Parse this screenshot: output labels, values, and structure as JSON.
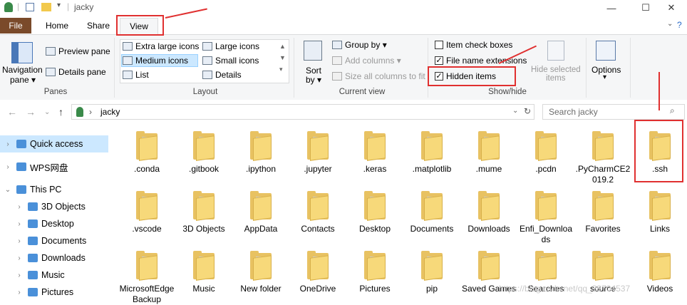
{
  "window": {
    "title": "jacky",
    "controls": {
      "minimize": "—",
      "maximize": "☐",
      "close": "✕"
    }
  },
  "ribbon_tabs": [
    "File",
    "Home",
    "Share",
    "View"
  ],
  "ribbon": {
    "panes": {
      "label": "Panes",
      "navigation_pane": "Navigation",
      "navigation_pane_2": "pane ▾",
      "preview_pane": "Preview pane",
      "details_pane": "Details pane"
    },
    "layout": {
      "label": "Layout",
      "options": [
        "Extra large icons",
        "Large icons",
        "Medium icons",
        "Small icons",
        "List",
        "Details"
      ]
    },
    "current_view": {
      "label": "Current view",
      "sort_by_1": "Sort",
      "sort_by_2": "by ▾",
      "group_by": "Group by ▾",
      "add_columns": "Add columns ▾",
      "size_columns": "Size all columns to fit"
    },
    "show_hide": {
      "label": "Show/hide",
      "item_check_boxes": "Item check boxes",
      "file_name_extensions": "File name extensions",
      "hidden_items": "Hidden items",
      "hide_selected_1": "Hide selected",
      "hide_selected_2": "items"
    },
    "options": {
      "label": "Options",
      "sub": "▾"
    }
  },
  "address": {
    "path": "jacky",
    "search_placeholder": "Search jacky"
  },
  "nav": [
    {
      "label": "Quick access",
      "chev": "›",
      "selected": true
    },
    {
      "label": "WPS网盘",
      "chev": "›"
    },
    {
      "label": "This PC",
      "chev": "⌄"
    },
    {
      "label": "3D Objects",
      "chev": "›"
    },
    {
      "label": "Desktop",
      "chev": "›"
    },
    {
      "label": "Documents",
      "chev": "›"
    },
    {
      "label": "Downloads",
      "chev": "›"
    },
    {
      "label": "Music",
      "chev": "›"
    },
    {
      "label": "Pictures",
      "chev": "›"
    }
  ],
  "items": [
    ".conda",
    ".gitbook",
    ".ipython",
    ".jupyter",
    ".keras",
    ".matplotlib",
    ".mume",
    ".pcdn",
    ".PyCharmCE2019.2",
    ".ssh",
    ".vscode",
    "3D Objects",
    "AppData",
    "Contacts",
    "Desktop",
    "Documents",
    "Downloads",
    "Enfi_Downloads",
    "Favorites",
    "Links",
    "MicrosoftEdgeBackup",
    "Music",
    "New folder",
    "OneDrive",
    "Pictures",
    "pip",
    "Saved Games",
    "Searches",
    "source",
    "Videos"
  ],
  "watermark": "https://blog.csdn.net/qq_38704537",
  "accent": {
    "red": "#e03030",
    "file_tab": "#7a4a2a",
    "selection": "#cce8ff"
  }
}
